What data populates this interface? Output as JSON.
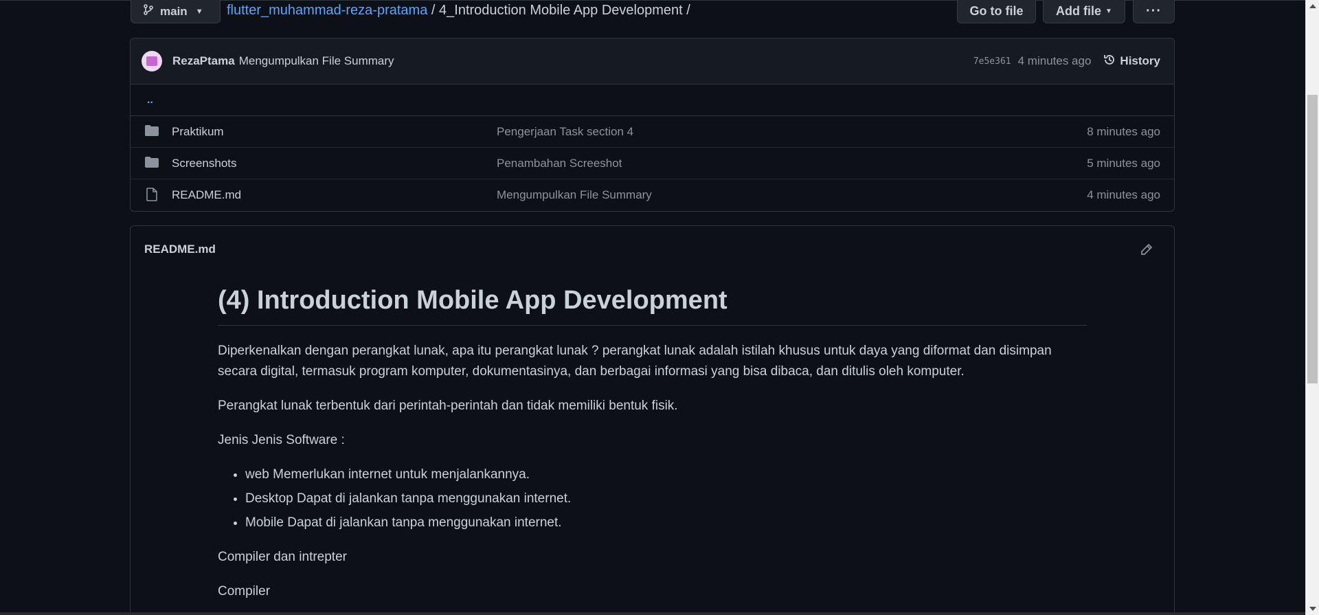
{
  "toolbar": {
    "branch": "main",
    "repo": "flutter_muhammad-reza-pratama",
    "separator": "/",
    "directory": "4_Introduction Mobile App Development",
    "trailing_separator": "/",
    "goto_file": "Go to file",
    "add_file": "Add file",
    "more": "···"
  },
  "commit": {
    "author": "RezaPtama",
    "message": "Mengumpulkan File Summary",
    "sha": "7e5e361",
    "time": "4 minutes ago",
    "history": "History"
  },
  "files": {
    "parent": "..",
    "items": [
      {
        "name": "Praktikum",
        "type": "folder",
        "message": "Pengerjaan Task section 4",
        "time": "8 minutes ago"
      },
      {
        "name": "Screenshots",
        "type": "folder",
        "message": "Penambahan Screeshot",
        "time": "5 minutes ago"
      },
      {
        "name": "README.md",
        "type": "file",
        "message": "Mengumpulkan File Summary",
        "time": "4 minutes ago"
      }
    ]
  },
  "readme": {
    "filename": "README.md",
    "title": "(4) Introduction Mobile App Development",
    "p1": "Diperkenalkan dengan perangkat lunak, apa itu perangkat lunak ? perangkat lunak adalah istilah khusus untuk daya yang diformat dan disimpan secara digital, termasuk program komputer, dokumentasinya, dan berbagai informasi yang bisa dibaca, dan ditulis oleh komputer.",
    "p2": "Perangkat lunak terbentuk dari perintah-perintah dan tidak memiliki bentuk fisik.",
    "p3": "Jenis Jenis Software :",
    "list": [
      "web Memerlukan internet untuk menjalankannya.",
      "Desktop Dapat di jalankan tanpa menggunakan internet.",
      "Mobile Dapat di jalankan tanpa menggunakan internet."
    ],
    "p4": "Compiler dan intrepter",
    "p5": "Compiler"
  },
  "icons": {
    "branch": "git-branch-icon",
    "history": "clock-history-icon",
    "folder": "folder-icon",
    "file": "file-icon",
    "edit": "pencil-icon"
  },
  "colors": {
    "background": "#0d1117",
    "link": "#58a6ff",
    "muted": "#8b949e",
    "text": "#c9d1d9"
  }
}
